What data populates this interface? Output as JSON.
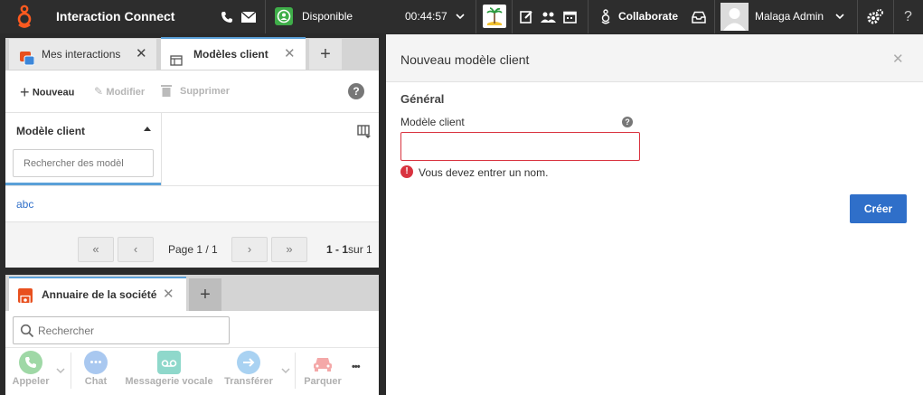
{
  "app": {
    "title": "Interaction Connect"
  },
  "topbar": {
    "status": "Disponible",
    "timer": "00:44:57",
    "collaborate": "Collaborate",
    "user": "Malaga Admin",
    "help": "?"
  },
  "left_top": {
    "tabs": [
      {
        "label": "Mes interactions",
        "icon": "interactions-icon"
      },
      {
        "label": "Modèles client",
        "icon": "table-icon"
      }
    ],
    "add_tab": "+",
    "toolbar": {
      "new": "Nouveau",
      "edit": "Modifier",
      "delete": "Supprimer"
    },
    "column_header": "Modèle client",
    "search_placeholder": "Rechercher des modèl",
    "rows": [
      "abc"
    ],
    "pager": {
      "first": "«",
      "prev": "‹",
      "page_text": "Page 1 / 1",
      "next": "›",
      "last": "»",
      "range_bold": "1 - 1",
      "range_rest": "sur 1"
    }
  },
  "left_bottom": {
    "tab": "Annuaire de la société",
    "add_tab": "+",
    "search_placeholder": "Rechercher",
    "dock": {
      "call": "Appeler",
      "chat": "Chat",
      "voicemail": "Messagerie vocale",
      "transfer": "Transférer",
      "park": "Parquer",
      "more": "•••"
    }
  },
  "dialog": {
    "title": "Nouveau modèle client",
    "section": "Général",
    "field_label": "Modèle client",
    "field_value": "",
    "error": "Vous devez entrer un nom.",
    "create": "Créer"
  },
  "colors": {
    "accent": "#2f6fc9",
    "error": "#d9333f",
    "brand": "#e8501e",
    "topbar": "#2d2d2d"
  }
}
